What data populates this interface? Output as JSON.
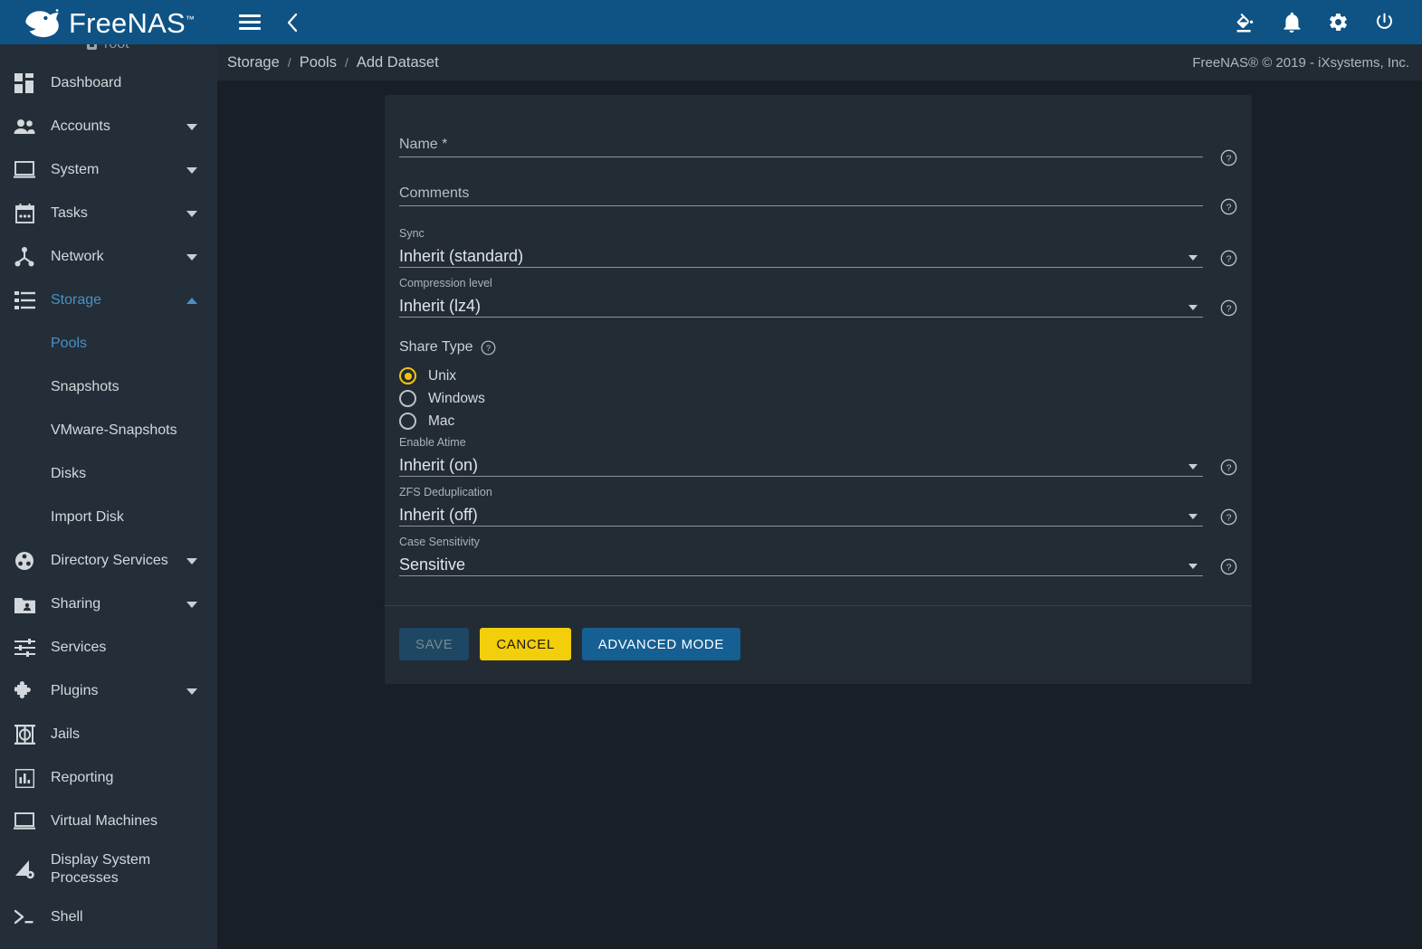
{
  "brand": {
    "name": "FreeNAS",
    "tm": "™"
  },
  "topbar": {
    "menu_icon": "hamburger-icon",
    "back_icon": "chevron-left-icon",
    "actions": [
      {
        "name": "theme-icon",
        "label": "Change Theme"
      },
      {
        "name": "notifications-icon",
        "label": "Notifications"
      },
      {
        "name": "gear-icon",
        "label": "Settings"
      },
      {
        "name": "power-icon",
        "label": "Power"
      }
    ]
  },
  "sidebar": {
    "user": "root",
    "items": [
      {
        "label": "Dashboard",
        "icon": "dashboard-icon",
        "expandable": false,
        "active": false
      },
      {
        "label": "Accounts",
        "icon": "accounts-icon",
        "expandable": true,
        "active": false
      },
      {
        "label": "System",
        "icon": "system-icon",
        "expandable": true,
        "active": false
      },
      {
        "label": "Tasks",
        "icon": "tasks-icon",
        "expandable": true,
        "active": false
      },
      {
        "label": "Network",
        "icon": "network-icon",
        "expandable": true,
        "active": false
      },
      {
        "label": "Storage",
        "icon": "storage-icon",
        "expandable": true,
        "active": true,
        "expanded": true
      },
      {
        "label": "Pools",
        "icon": "",
        "sub": true,
        "active": true
      },
      {
        "label": "Snapshots",
        "icon": "",
        "sub": true,
        "active": false
      },
      {
        "label": "VMware-Snapshots",
        "icon": "",
        "sub": true,
        "active": false
      },
      {
        "label": "Disks",
        "icon": "",
        "sub": true,
        "active": false
      },
      {
        "label": "Import Disk",
        "icon": "",
        "sub": true,
        "active": false
      },
      {
        "label": "Directory Services",
        "icon": "directory-services-icon",
        "expandable": true,
        "active": false
      },
      {
        "label": "Sharing",
        "icon": "sharing-icon",
        "expandable": true,
        "active": false
      },
      {
        "label": "Services",
        "icon": "services-icon",
        "expandable": false,
        "active": false
      },
      {
        "label": "Plugins",
        "icon": "plugins-icon",
        "expandable": true,
        "active": false
      },
      {
        "label": "Jails",
        "icon": "jails-icon",
        "expandable": false,
        "active": false
      },
      {
        "label": "Reporting",
        "icon": "reporting-icon",
        "expandable": false,
        "active": false
      },
      {
        "label": "Virtual Machines",
        "icon": "virtual-machines-icon",
        "expandable": false,
        "active": false
      },
      {
        "label": "Display System Processes",
        "icon": "display-system-processes-icon",
        "expandable": false,
        "active": false
      },
      {
        "label": "Shell",
        "icon": "shell-icon",
        "expandable": false,
        "active": false
      }
    ]
  },
  "breadcrumb": {
    "items": [
      "Storage",
      "Pools",
      "Add Dataset"
    ],
    "separator": "/"
  },
  "copyright": "FreeNAS® © 2019 - iXsystems, Inc.",
  "form": {
    "name": {
      "label": "Name *",
      "value": "",
      "placeholder": "Name *"
    },
    "comments": {
      "label": "Comments",
      "value": "",
      "placeholder": "Comments"
    },
    "sync": {
      "label": "Sync",
      "value": "Inherit (standard)"
    },
    "compression": {
      "label": "Compression level",
      "value": "Inherit (lz4)"
    },
    "share_type": {
      "label": "Share Type",
      "options": [
        "Unix",
        "Windows",
        "Mac"
      ],
      "selected": "Unix"
    },
    "atime": {
      "label": "Enable Atime",
      "value": "Inherit (on)"
    },
    "dedup": {
      "label": "ZFS Deduplication",
      "value": "Inherit (off)"
    },
    "case_sensitivity": {
      "label": "Case Sensitivity",
      "value": "Sensitive"
    },
    "help_icon": "help-circle-icon"
  },
  "buttons": {
    "save": "SAVE",
    "cancel": "CANCEL",
    "advanced": "ADVANCED MODE"
  },
  "colors": {
    "header_blue": "#0f5384",
    "accent_blue": "#4a90c4",
    "cancel_yellow": "#f2ce0b",
    "advanced_blue": "#155f93",
    "radio_selected": "#f1c40f",
    "page_bg": "#181f26",
    "sidebar_bg": "#242e38",
    "card_bg": "#232c35"
  }
}
